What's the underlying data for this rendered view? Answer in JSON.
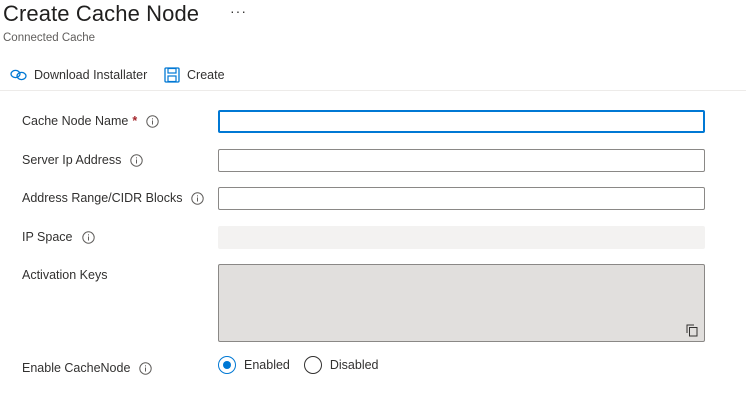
{
  "page": {
    "title": "Create Cache Node",
    "subtitle": "Connected Cache",
    "more_label": "···"
  },
  "toolbar": {
    "download_label": "Download Installater",
    "create_label": "Create"
  },
  "form": {
    "cache_node_name": {
      "label": "Cache Node Name",
      "required_mark": "*",
      "value": ""
    },
    "server_ip": {
      "label": "Server Ip Address",
      "value": ""
    },
    "address_range": {
      "label": "Address Range/CIDR Blocks",
      "value": ""
    },
    "ip_space": {
      "label": "IP Space",
      "value": ""
    },
    "activation_keys": {
      "label": "Activation Keys",
      "value": ""
    },
    "enable_cachenode": {
      "label": "Enable CacheNode",
      "options": [
        "Enabled",
        "Disabled"
      ],
      "selected": "Enabled"
    }
  },
  "icons": {
    "download": "link-chain-icon",
    "create": "save-floppy-icon",
    "info": "info-circle-icon",
    "copy": "copy-icon"
  },
  "colors": {
    "accent": "#0078d4",
    "required": "#a4262c",
    "disabled_bg": "#f3f2f1",
    "readonly_area": "#e1dfdd"
  }
}
